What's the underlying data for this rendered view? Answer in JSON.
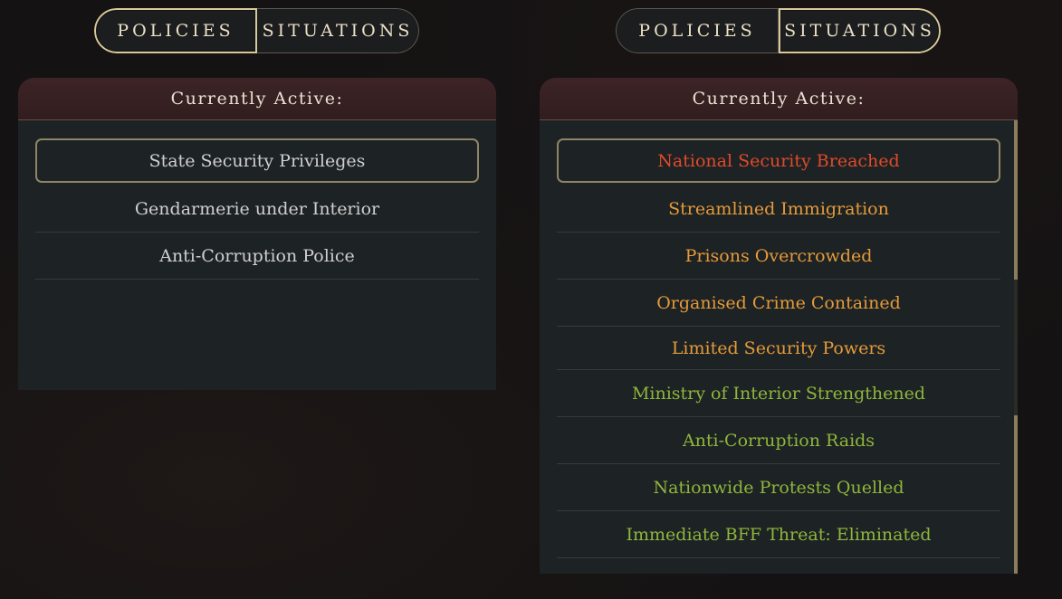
{
  "left": {
    "tabs": [
      {
        "label": "POLICIES",
        "active": true
      },
      {
        "label": "SITUATIONS",
        "active": false
      }
    ],
    "panel": {
      "header": "Currently Active:",
      "items": [
        {
          "label": "State Security Privileges",
          "color": "#cfcfcf",
          "selected": true
        },
        {
          "label": "Gendarmerie under Interior",
          "color": "#cfcfcf"
        },
        {
          "label": "Anti-Corruption Police",
          "color": "#cfcfcf"
        }
      ]
    }
  },
  "right": {
    "tabs": [
      {
        "label": "POLICIES",
        "active": false
      },
      {
        "label": "SITUATIONS",
        "active": true
      }
    ],
    "panel": {
      "header": "Currently Active:",
      "items": [
        {
          "label": "National Security Breached",
          "color": "#e04a2a",
          "selected": true
        },
        {
          "label": "Streamlined Immigration",
          "color": "#e59a3a"
        },
        {
          "label": "Prisons Overcrowded",
          "color": "#e59a3a"
        },
        {
          "label": "Organised Crime Contained",
          "color": "#e59a3a"
        },
        {
          "label": "Limited Security Powers",
          "color": "#e59a3a"
        },
        {
          "label": "Ministry of Interior Strengthened",
          "color": "#8fb53c"
        },
        {
          "label": "Anti-Corruption Raids",
          "color": "#8fb53c"
        },
        {
          "label": "Nationwide Protests Quelled",
          "color": "#8fb53c"
        },
        {
          "label": "Immediate BFF Threat: Eliminated",
          "color": "#8fb53c"
        }
      ]
    }
  }
}
